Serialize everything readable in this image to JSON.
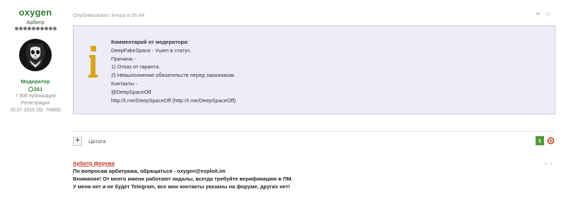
{
  "author": {
    "username": "oxygen",
    "title": "Арбитр",
    "role": "Модератор",
    "reputation": "261",
    "posts": "7 908 публикаций",
    "registered_label": "Регистрация",
    "registered": "20.07.2016 (ID: 70885)"
  },
  "post": {
    "published": "Опубликовано: вчера в 06:44",
    "moderator_box": {
      "heading": "Комментарий от модератора:",
      "lines": [
        "DeepFakeSpace - Ушел в статус.",
        "Причина -",
        "1) Отказ от гаранта.",
        "2) Невыполнение обязательств перед заказчиком.",
        "Контакты -",
        "@DeepSpaceOff",
        "http://t.me/DeepSpaceOff (http://t.me/DeepSpaceOff)"
      ]
    }
  },
  "actions": {
    "plus": "+",
    "quote": "Цитата",
    "likes": "1"
  },
  "signature": {
    "title": "Арбитр форума",
    "lines": [
      "По вопросам арбитража, обращаться - oxygen@exploit.im",
      "Внимание! От моего имени работают кидалы, всегда требуйте верификацию в ПМ.",
      "У меня нет и не будет Telegram, все мои контакты указаны на форуме, других нет!"
    ]
  },
  "colors": {
    "username": "#2e7d32",
    "signature_title": "#c0392b",
    "like_badge": "#4f9a3a",
    "mod_box_bg": "#ecedf7",
    "mod_icon": "#d9a520"
  },
  "icons": {
    "avatar": "skull-avatar",
    "moderator": "info-icon",
    "like": "like-icon",
    "reputation": "reputation-icon"
  }
}
